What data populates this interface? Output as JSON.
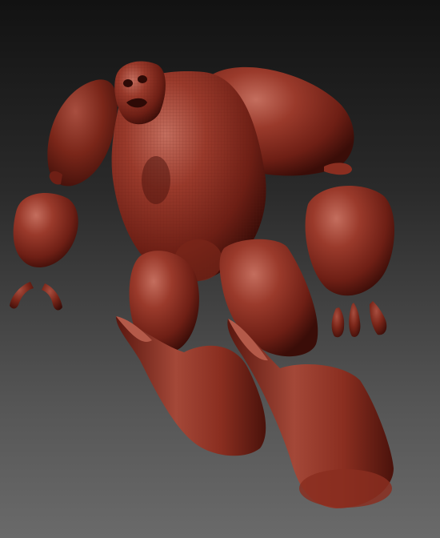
{
  "viewport": {
    "background_top": "#121212",
    "background_bottom": "#6a6a6a"
  },
  "model": {
    "name": "",
    "material_color": "#8a2e20",
    "highlight_color": "#c06a5a",
    "shadow_color": "#3a0d08"
  }
}
